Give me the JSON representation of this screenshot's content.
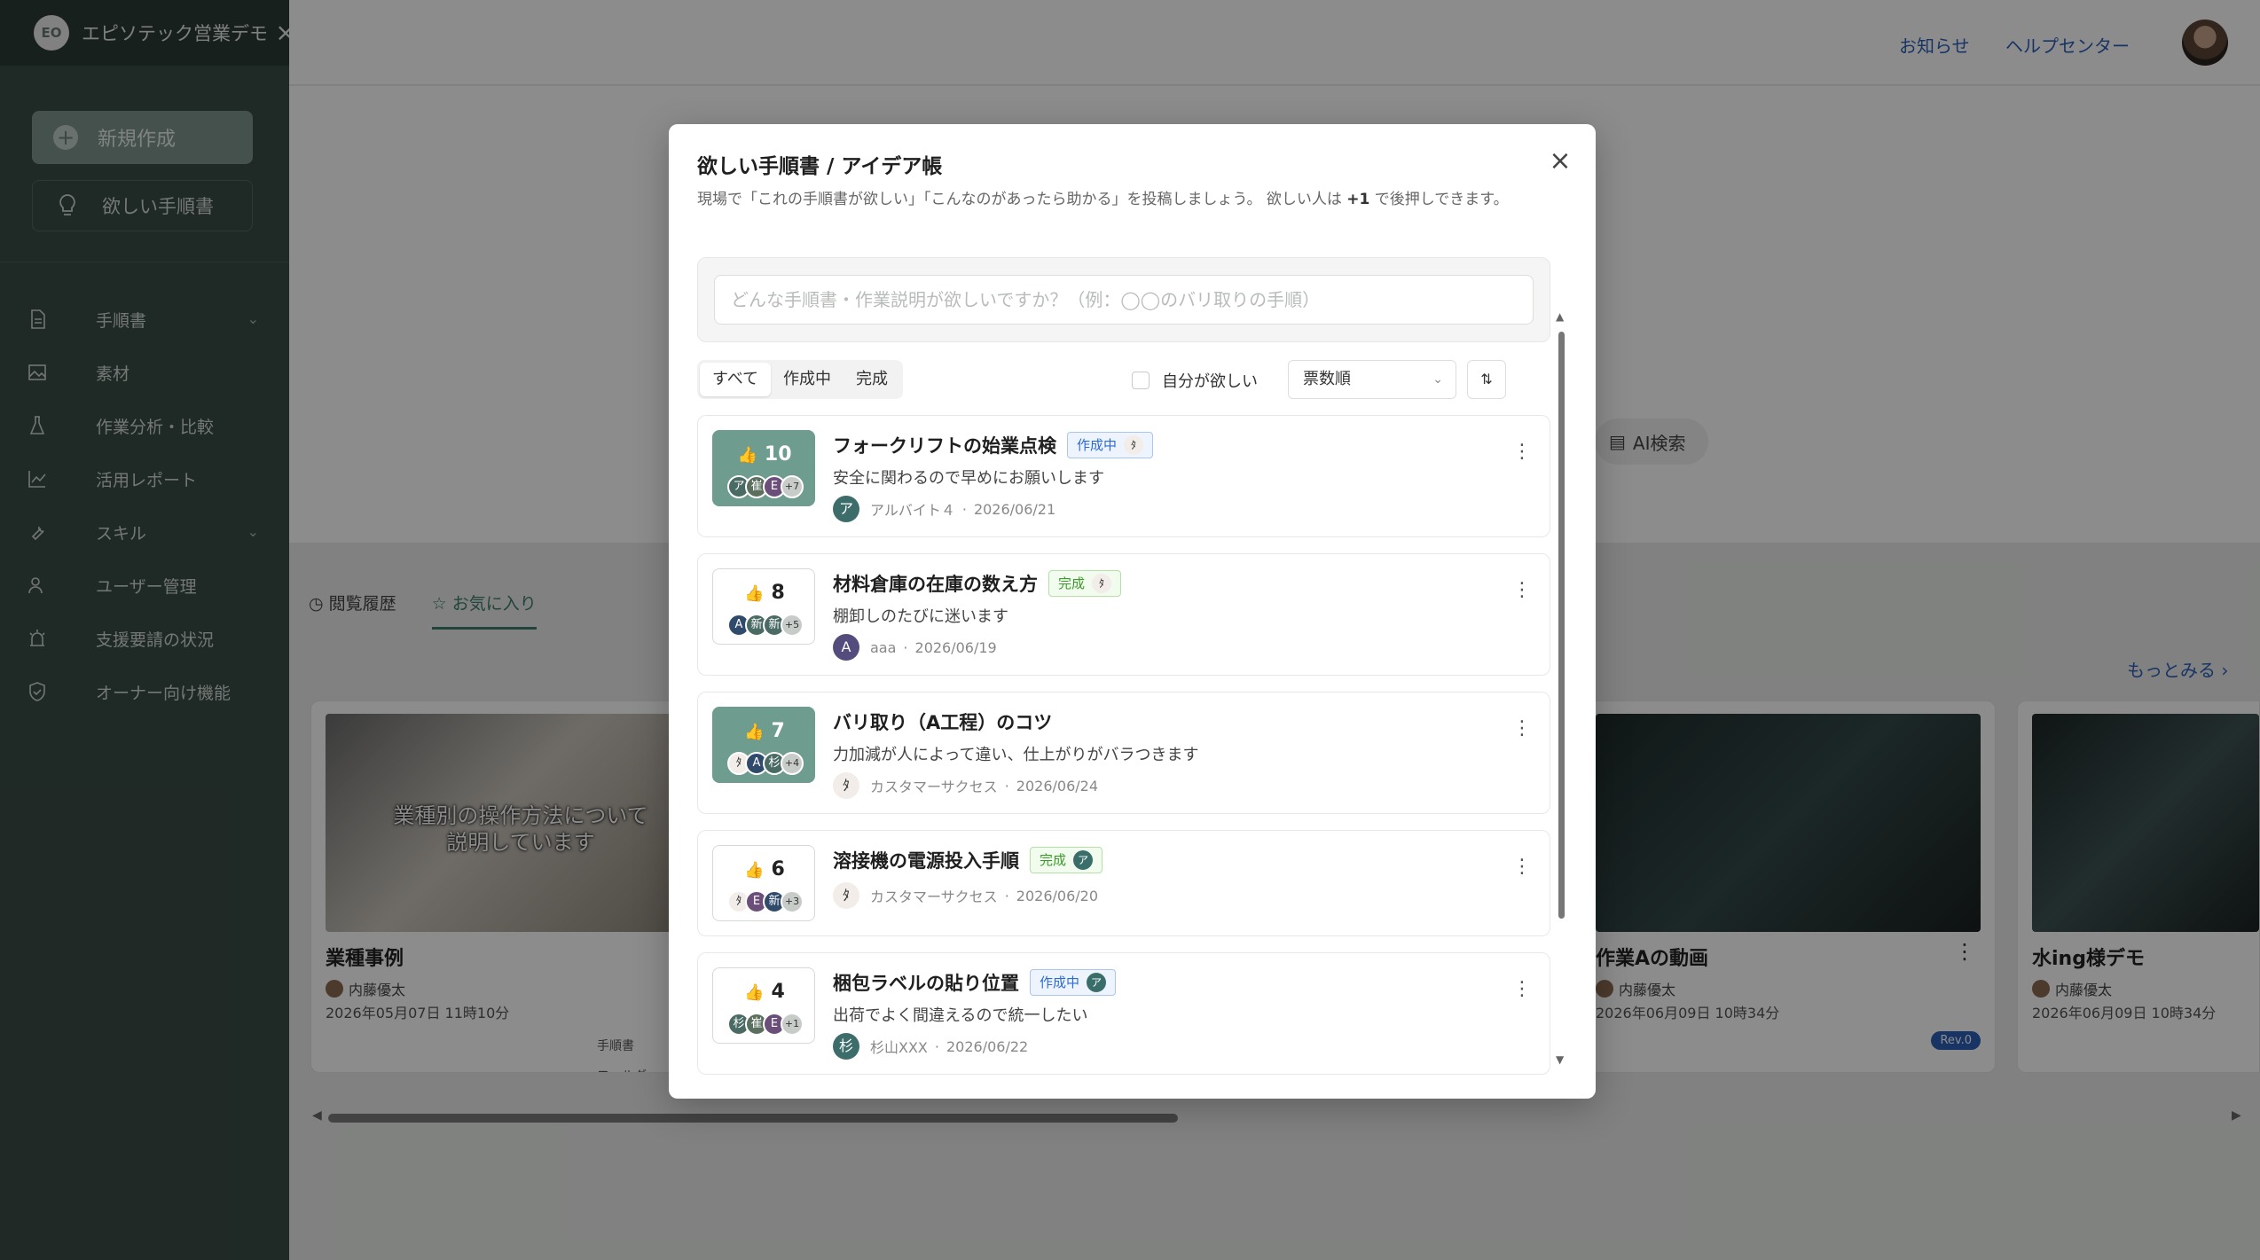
{
  "sidebar": {
    "brand": "エピソテック営業デモ",
    "new_label": "新規作成",
    "wish_label": "欲しい手順書",
    "nav": [
      {
        "label": "手順書",
        "icon": "document-icon",
        "has_children": true
      },
      {
        "label": "素材",
        "icon": "image-icon",
        "has_children": false
      },
      {
        "label": "作業分析・比較",
        "icon": "flask-icon",
        "has_children": false
      },
      {
        "label": "活用レポート",
        "icon": "chart-icon",
        "has_children": false
      },
      {
        "label": "スキル",
        "icon": "wrench-icon",
        "has_children": true
      },
      {
        "label": "ユーザー管理",
        "icon": "users-icon",
        "has_children": false
      },
      {
        "label": "支援要請の状況",
        "icon": "alarm-icon",
        "has_children": false
      },
      {
        "label": "オーナー向け機能",
        "icon": "shield-icon",
        "has_children": false
      }
    ]
  },
  "header": {
    "news": "お知らせ",
    "help": "ヘルプセンター"
  },
  "main": {
    "ai_search": "AI検索",
    "tabs": [
      "閲覧履歴",
      "お気に入り"
    ],
    "more": "もっとみる",
    "cards": [
      {
        "title": "業種事例",
        "author": "内藤優太",
        "date": "2026年05月07日 11時10分",
        "caption": "業種別の操作方法について説明しています",
        "tags": [
          "手順書",
          "フォルダ"
        ]
      },
      {
        "title": "作業Aの動画",
        "author": "内藤優太",
        "date": "2026年06月09日 10時34分",
        "rev": "Rev.0"
      },
      {
        "title": "水ing様デモ",
        "author": "内藤優太",
        "date": "2026年06月09日 10時34分"
      }
    ]
  },
  "modal": {
    "title": "欲しい手順書 / アイデア帳",
    "desc_before": "現場で「これの手順書が欲しい」「こんなのがあったら助かる」を投稿しましょう。 欲しい人は ",
    "desc_bold": "+1",
    "desc_after": " で後押しできます。",
    "placeholder": "どんな手順書・作業説明が欲しいですか？（例：◯◯のバリ取りの手順）",
    "filters": [
      "すべて",
      "作成中",
      "完成"
    ],
    "mine_label": "自分が欲しい",
    "sort_label": "票数順",
    "ideas": [
      {
        "votes": "10",
        "voted": true,
        "title": "フォークリフトの始業点検",
        "status": "作成中",
        "status_type": "prog",
        "body": "安全に関わるので早めにお願いします",
        "author": "アルバイト４",
        "date": "2026/06/21",
        "faces": [
          "ア",
          "崔",
          "E"
        ],
        "more": "+7"
      },
      {
        "votes": "8",
        "voted": false,
        "title": "材料倉庫の在庫の数え方",
        "status": "完成",
        "status_type": "done",
        "body": "棚卸しのたびに迷います",
        "author": "aaa",
        "date": "2026/06/19",
        "faces": [
          "A",
          "新",
          "新"
        ],
        "more": "+5"
      },
      {
        "votes": "7",
        "voted": true,
        "title": "バリ取り（A工程）のコツ",
        "status": "",
        "status_type": "",
        "body": "力加減が人によって違い、仕上がりがバラつきます",
        "author": "カスタマーサクセス",
        "date": "2026/06/24",
        "faces": [
          "ﾀ",
          "A",
          "杉"
        ],
        "more": "+4"
      },
      {
        "votes": "6",
        "voted": false,
        "title": "溶接機の電源投入手順",
        "status": "完成",
        "status_type": "done",
        "body": "",
        "author": "カスタマーサクセス",
        "date": "2026/06/20",
        "faces": [
          "ﾀ",
          "E",
          "新"
        ],
        "more": "+3"
      },
      {
        "votes": "4",
        "voted": false,
        "title": "梱包ラベルの貼り位置",
        "status": "作成中",
        "status_type": "prog",
        "body": "出荷でよく間違えるので統一したい",
        "author": "杉山XXX",
        "date": "2026/06/22",
        "faces": [
          "杉",
          "崔",
          "E"
        ],
        "more": "+1"
      }
    ],
    "status_avatars": [
      "",
      "",
      "",
      "ア",
      "ア"
    ],
    "author_initials": [
      "ア",
      "A",
      "",
      "",
      "杉"
    ]
  }
}
